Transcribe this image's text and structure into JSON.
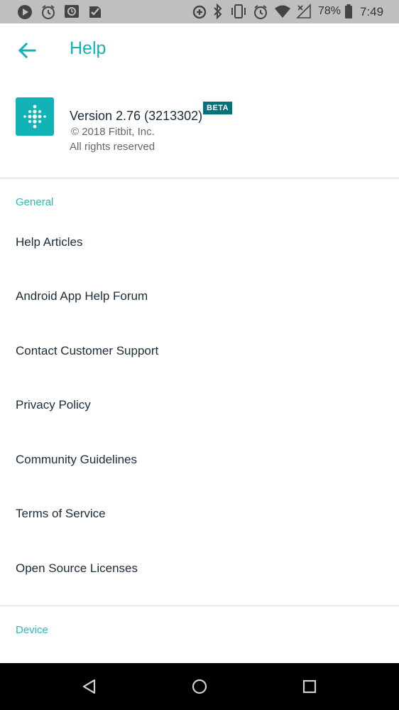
{
  "status_bar": {
    "battery": "78%",
    "time": "7:49",
    "left_icons": [
      "play-store-icon",
      "alarm-icon",
      "schedule-icon",
      "tasks-icon"
    ],
    "right_icons": [
      "data-saver-icon",
      "bluetooth-icon",
      "vibrate-icon",
      "alarm-icon",
      "wifi-icon",
      "no-signal-icon",
      "battery-icon"
    ]
  },
  "header": {
    "title": "Help",
    "back_icon": "arrow-back-icon"
  },
  "app_info": {
    "version": "Version 2.76 (3213302)",
    "badge": "BETA",
    "copyright": "© 2018 Fitbit, Inc.",
    "rights": "All rights reserved",
    "logo_icon": "fitbit-logo-icon"
  },
  "sections": {
    "general": {
      "header": "General",
      "items": [
        "Help Articles",
        "Android App Help Forum",
        "Contact Customer Support",
        "Privacy Policy",
        "Community Guidelines",
        "Terms of Service",
        "Open Source Licenses"
      ]
    },
    "device": {
      "header": "Device"
    }
  },
  "nav_bar": {
    "icons": [
      "back-triangle-icon",
      "home-circle-icon",
      "recents-square-icon"
    ]
  },
  "colors": {
    "accent": "#12b3b7",
    "badge": "#00747a",
    "text": "#1a2b3a",
    "status_bar": "#bfbfbf"
  }
}
